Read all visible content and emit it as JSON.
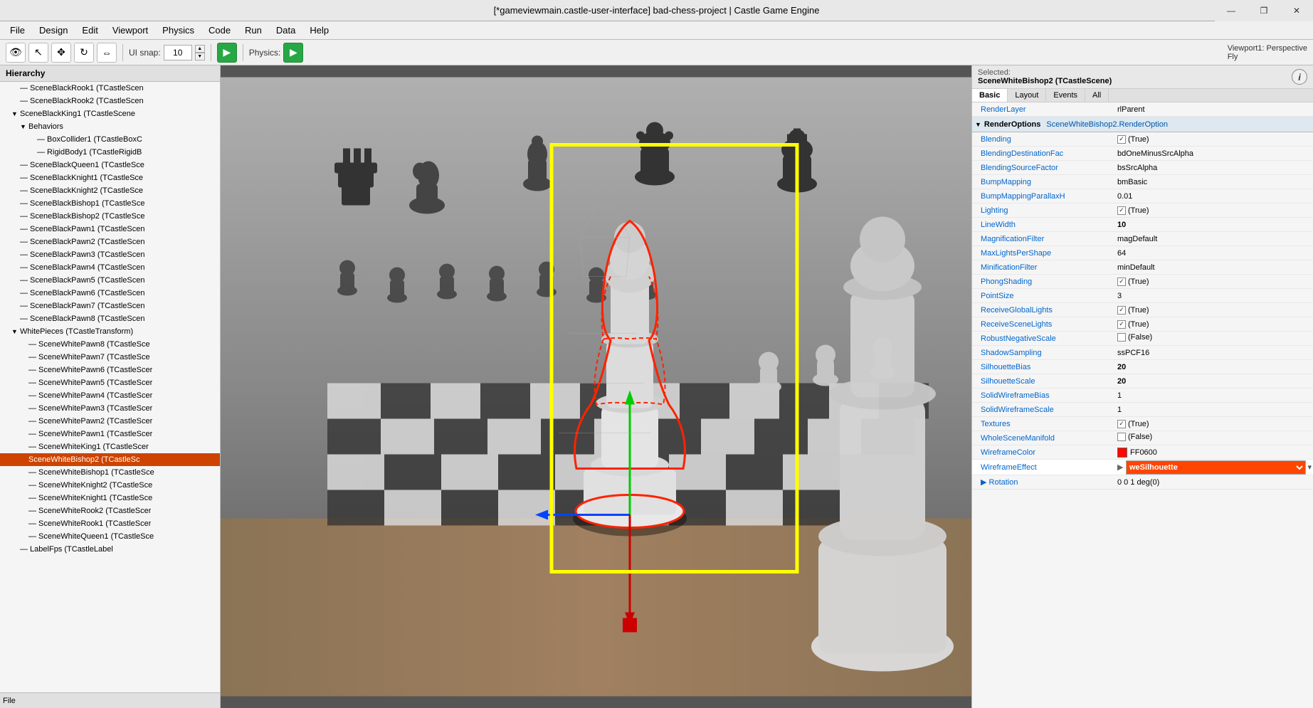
{
  "title": "[*gameviewmain.castle-user-interface] bad-chess-project | Castle Game Engine",
  "windowControls": {
    "minimize": "—",
    "maximize": "❐",
    "close": "✕"
  },
  "menu": {
    "items": [
      "File",
      "Design",
      "Edit",
      "Viewport",
      "Physics",
      "Code",
      "Run",
      "Data",
      "Help"
    ]
  },
  "toolbar": {
    "uiSnapLabel": "UI snap:",
    "uiSnapValue": "10",
    "physicsLabel": "Physics:",
    "viewport": {
      "line1": "Viewport1: Perspective",
      "line2": "Fly"
    }
  },
  "hierarchy": {
    "title": "Hierarchy",
    "items": [
      {
        "level": 1,
        "toggle": "",
        "label": "SceneBlackRook1 (TCastleScene"
      },
      {
        "level": 1,
        "toggle": "",
        "label": "SceneBlackRook2 (TCastleScene"
      },
      {
        "level": 1,
        "toggle": "▼",
        "label": "SceneBlackKing1 (TCastleScene"
      },
      {
        "level": 2,
        "toggle": "▼",
        "label": "Behaviors"
      },
      {
        "level": 3,
        "toggle": "",
        "label": "BoxCollider1 (TCastleBoxC"
      },
      {
        "level": 3,
        "toggle": "",
        "label": "RigidBody1 (TCastleRigidB"
      },
      {
        "level": 1,
        "toggle": "",
        "label": "SceneBlackQueen1 (TCastleSce"
      },
      {
        "level": 1,
        "toggle": "",
        "label": "SceneBlackKnight1 (TCastleSce"
      },
      {
        "level": 1,
        "toggle": "",
        "label": "SceneBlackKnight2 (TCastleSce"
      },
      {
        "level": 1,
        "toggle": "",
        "label": "SceneBlackBishop1 (TCastleSce"
      },
      {
        "level": 1,
        "toggle": "",
        "label": "SceneBlackBishop2 (TCastleSce"
      },
      {
        "level": 1,
        "toggle": "",
        "label": "SceneBlackPawn1 (TCastleScen"
      },
      {
        "level": 1,
        "toggle": "",
        "label": "SceneBlackPawn2 (TCastleScen"
      },
      {
        "level": 1,
        "toggle": "",
        "label": "SceneBlackPawn3 (TCastleScen"
      },
      {
        "level": 1,
        "toggle": "",
        "label": "SceneBlackPawn4 (TCastleScen"
      },
      {
        "level": 1,
        "toggle": "",
        "label": "SceneBlackPawn5 (TCastleScen"
      },
      {
        "level": 1,
        "toggle": "",
        "label": "SceneBlackPawn6 (TCastleScen"
      },
      {
        "level": 1,
        "toggle": "",
        "label": "SceneBlackPawn7 (TCastleScen"
      },
      {
        "level": 1,
        "toggle": "",
        "label": "SceneBlackPawn8 (TCastleScen"
      },
      {
        "level": 1,
        "toggle": "▼",
        "label": "WhitePieces (TCastleTransform)"
      },
      {
        "level": 2,
        "toggle": "",
        "label": "SceneWhitePawn8 (TCastleSce"
      },
      {
        "level": 2,
        "toggle": "",
        "label": "SceneWhitePawn7 (TCastleSce"
      },
      {
        "level": 2,
        "toggle": "",
        "label": "SceneWhitePawn6 (TCastleScer"
      },
      {
        "level": 2,
        "toggle": "",
        "label": "SceneWhitePawn5 (TCastleScer"
      },
      {
        "level": 2,
        "toggle": "",
        "label": "SceneWhitePawn4 (TCastleScer"
      },
      {
        "level": 2,
        "toggle": "",
        "label": "SceneWhitePawn3 (TCastleScer"
      },
      {
        "level": 2,
        "toggle": "",
        "label": "SceneWhitePawn2 (TCastleScer"
      },
      {
        "level": 2,
        "toggle": "",
        "label": "SceneWhitePawn1 (TCastleScer"
      },
      {
        "level": 2,
        "toggle": "",
        "label": "SceneWhiteKing1 (TCastleScer"
      },
      {
        "level": 2,
        "toggle": "",
        "label": "SceneWhiteBishop2 (TCastleSc",
        "selected": true
      },
      {
        "level": 2,
        "toggle": "",
        "label": "SceneWhiteBishop1 (TCastleSce"
      },
      {
        "level": 2,
        "toggle": "",
        "label": "SceneWhiteKnight2 (TCastleSce"
      },
      {
        "level": 2,
        "toggle": "",
        "label": "SceneWhiteKnight1 (TCastleSce"
      },
      {
        "level": 2,
        "toggle": "",
        "label": "SceneWhiteRook2 (TCastleScer"
      },
      {
        "level": 2,
        "toggle": "",
        "label": "SceneWhiteRook1 (TCastleScer"
      },
      {
        "level": 2,
        "toggle": "",
        "label": "SceneWhiteQueen1 (TCastleSce"
      },
      {
        "level": 1,
        "toggle": "",
        "label": "LabelFps (TCastleLabel"
      }
    ]
  },
  "selected": {
    "header1": "Selected:",
    "header2": "SceneWhiteBishop2 (TCastleScene)"
  },
  "propsTabs": [
    "Basic",
    "Layout",
    "Events",
    "All"
  ],
  "propsActiveTab": "Basic",
  "renderLayer": {
    "name": "RenderLayer",
    "value": "rlParent"
  },
  "renderOptionsGroup": {
    "name": "RenderOptions",
    "value": "SceneWhiteBishop2.RenderOption"
  },
  "properties": [
    {
      "name": "Blending",
      "value": "(True)",
      "checkbox": true,
      "checked": true
    },
    {
      "name": "BlendingDestinationFac",
      "value": "bdOneMinusSrcAlpha"
    },
    {
      "name": "BlendingSourceFactor",
      "value": "bsSrcAlpha"
    },
    {
      "name": "BumpMapping",
      "value": "bmBasic"
    },
    {
      "name": "BumpMappingParallaxH",
      "value": "0.01"
    },
    {
      "name": "Lighting",
      "value": "(True)",
      "checkbox": true,
      "checked": true
    },
    {
      "name": "LineWidth",
      "value": "10",
      "bold": true
    },
    {
      "name": "MagnificationFilter",
      "value": "magDefault"
    },
    {
      "name": "MaxLightsPerShape",
      "value": "64"
    },
    {
      "name": "MinificationFilter",
      "value": "minDefault"
    },
    {
      "name": "PhongShading",
      "value": "(True)",
      "checkbox": true,
      "checked": true
    },
    {
      "name": "PointSize",
      "value": "3"
    },
    {
      "name": "ReceiveGlobalLights",
      "value": "(True)",
      "checkbox": true,
      "checked": true
    },
    {
      "name": "ReceiveSceneLights",
      "value": "(True)",
      "checkbox": true,
      "checked": true
    },
    {
      "name": "RobustNegativeScale",
      "value": "(False)",
      "checkbox": true,
      "checked": false
    },
    {
      "name": "ShadowSampling",
      "value": "ssPCF16"
    },
    {
      "name": "SilhouetteBias",
      "value": "20",
      "bold": true
    },
    {
      "name": "SilhouetteScale",
      "value": "20",
      "bold": true
    },
    {
      "name": "SolidWireframeBias",
      "value": "1"
    },
    {
      "name": "SolidWireframeScale",
      "value": "1"
    },
    {
      "name": "Textures",
      "value": "(True)",
      "checkbox": true,
      "checked": true
    },
    {
      "name": "WholeSceneManifold",
      "value": "(False)",
      "checkbox": true,
      "checked": false
    },
    {
      "name": "WireframeColor",
      "value": "FF0600"
    },
    {
      "name": "WireframeEffect",
      "value": "weSilhouette",
      "highlighted": true,
      "dropdown": true
    },
    {
      "name": "Rotation",
      "value": "0 0 1 deg(0)"
    }
  ],
  "icons": {
    "eye": "👁",
    "cursor": "↖",
    "move": "✥",
    "rotate": "↻",
    "scale": "⇔",
    "play": "▶",
    "physics_play": "▶",
    "info": "i",
    "expand": "▶",
    "collapse": "▼",
    "chevron_down": "▾",
    "spin_up": "▲",
    "spin_down": "▼"
  },
  "colors": {
    "selected_item_bg": "#cc4400",
    "selected_item_fg": "#ffffff",
    "prop_name_color": "#0066cc",
    "wireframe_highlight": "#ff4500",
    "yellow_border": "#ffff00",
    "play_green": "#28a745"
  }
}
